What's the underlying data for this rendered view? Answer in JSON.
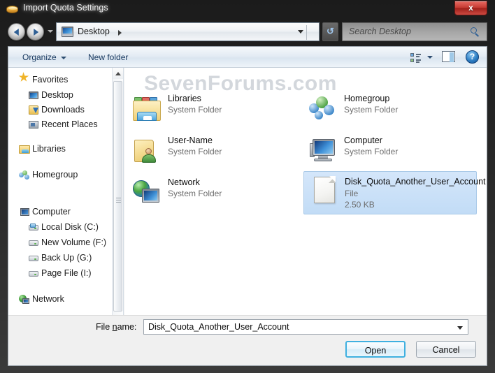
{
  "window": {
    "title": "Import Quota Settings",
    "title_icon": "disk-quota-icon",
    "close_label": "x"
  },
  "navbar": {
    "back_icon": "back-arrow-icon",
    "forward_icon": "forward-arrow-icon",
    "history_icon": "chevron-down-icon",
    "address": {
      "icon": "desktop-icon",
      "crumb": "Desktop",
      "separator_icon": "chevron-right-icon",
      "dropdown_icon": "chevron-down-icon"
    },
    "refresh_icon": "refresh-icon",
    "search": {
      "placeholder": "Search Desktop",
      "icon": "search-icon"
    }
  },
  "commandbar": {
    "organize": "Organize",
    "new_folder": "New folder",
    "view_icon": "view-mode-icon",
    "preview_pane_icon": "preview-pane-icon",
    "help_icon": "help-icon",
    "help_label": "?"
  },
  "watermark": "SevenForums.com",
  "sidebar": {
    "items": [
      {
        "label": "Favorites",
        "icon": "star-icon",
        "level": "root"
      },
      {
        "label": "Desktop",
        "icon": "desktop-icon",
        "level": "child"
      },
      {
        "label": "Downloads",
        "icon": "downloads-icon",
        "level": "child"
      },
      {
        "label": "Recent Places",
        "icon": "recent-places-icon",
        "level": "child"
      },
      {
        "label": "Libraries",
        "icon": "libraries-icon",
        "level": "root"
      },
      {
        "label": "Homegroup",
        "icon": "homegroup-icon",
        "level": "root"
      },
      {
        "label": "Computer",
        "icon": "computer-icon",
        "level": "root"
      },
      {
        "label": "Local Disk (C:)",
        "icon": "system-drive-icon",
        "level": "child"
      },
      {
        "label": "New Volume (F:)",
        "icon": "drive-icon",
        "level": "child"
      },
      {
        "label": "Back Up (G:)",
        "icon": "drive-icon",
        "level": "child"
      },
      {
        "label": "Page File (I:)",
        "icon": "drive-icon",
        "level": "child"
      },
      {
        "label": "Network",
        "icon": "network-icon",
        "level": "root"
      }
    ],
    "scroll": {
      "up_icon": "scroll-up-icon",
      "down_icon": "scroll-down-icon"
    }
  },
  "filelist": {
    "items": [
      {
        "name": "Libraries",
        "type": "System Folder",
        "size": "",
        "icon": "libraries-folder-icon",
        "selected": false
      },
      {
        "name": "Homegroup",
        "type": "System Folder",
        "size": "",
        "icon": "homegroup-icon",
        "selected": false
      },
      {
        "name": "User-Name",
        "type": "System Folder",
        "size": "",
        "icon": "user-folder-icon",
        "selected": false
      },
      {
        "name": "Computer",
        "type": "System Folder",
        "size": "",
        "icon": "computer-icon",
        "selected": false
      },
      {
        "name": "Network",
        "type": "System Folder",
        "size": "",
        "icon": "network-icon",
        "selected": false
      },
      {
        "name": "Disk_Quota_Another_User_Account",
        "type": "File",
        "size": "2.50 KB",
        "icon": "generic-file-icon",
        "selected": true
      }
    ]
  },
  "footer": {
    "filename_label_pre": "File ",
    "filename_label_accel": "n",
    "filename_label_post": "ame:",
    "filename_value": "Disk_Quota_Another_User_Account",
    "dropdown_icon": "chevron-down-icon",
    "open_label": "Open",
    "cancel_label": "Cancel"
  },
  "colors": {
    "selection": "#c2dcf6",
    "default_button_border": "#3fb0e0",
    "close_button": "#c43a32",
    "watermark": "#d3d7dc"
  }
}
